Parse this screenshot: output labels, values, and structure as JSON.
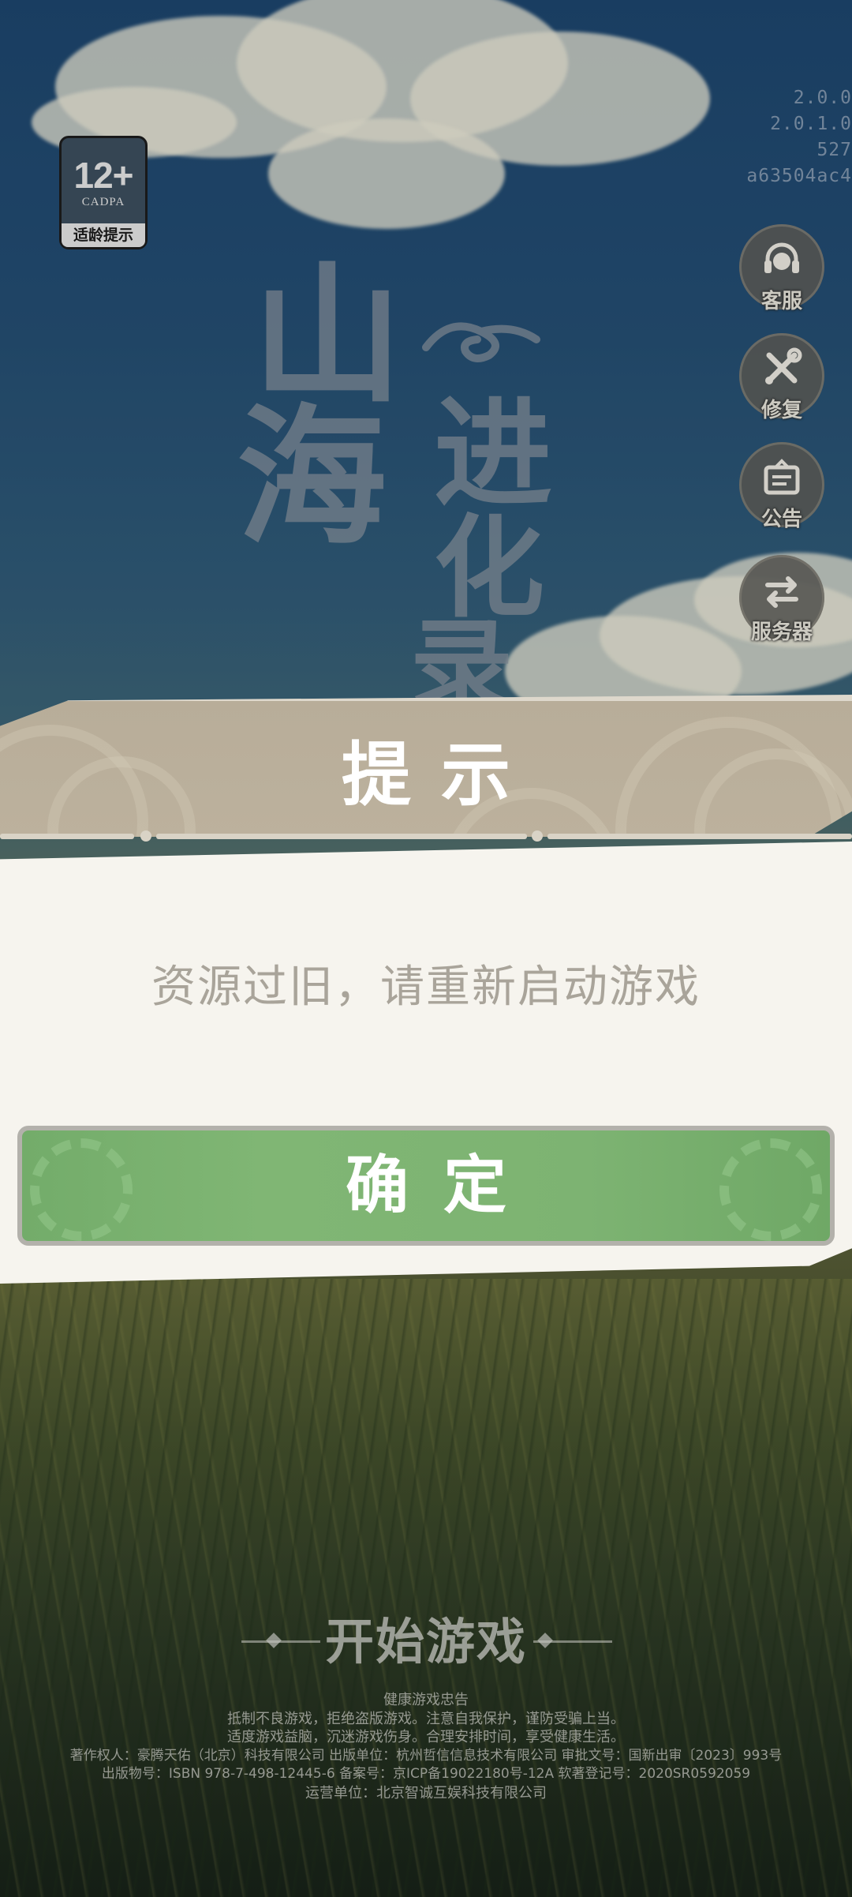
{
  "version": {
    "lines": [
      "2.0.0",
      "2.0.1.0",
      "527",
      "a63504ac4"
    ]
  },
  "age_rating": {
    "age": "12+",
    "org": "CADPA",
    "hint": "适龄提示"
  },
  "logo": {
    "chars": [
      "山",
      "海",
      "进",
      "化",
      "录"
    ]
  },
  "side_buttons": [
    {
      "label": "客服",
      "icon": "headset-icon"
    },
    {
      "label": "修复",
      "icon": "wrench-icon"
    },
    {
      "label": "公告",
      "icon": "notice-board-icon"
    },
    {
      "label": "服务器",
      "icon": "swap-arrows-icon"
    }
  ],
  "dialog": {
    "title": "提示",
    "message": "资源过旧，请重新启动游戏",
    "confirm_label": "确定"
  },
  "start_game": {
    "label": "开始游戏"
  },
  "footer": {
    "lines": [
      "健康游戏忠告",
      "抵制不良游戏，拒绝盗版游戏。注意自我保护，谨防受骗上当。",
      "适度游戏益脑，沉迷游戏伤身。合理安排时间，享受健康生活。",
      "著作权人：豪腾天佑（北京）科技有限公司  出版单位：杭州哲信信息技术有限公司  审批文号：国新出审〔2023〕993号",
      "出版物号：ISBN 978-7-498-12445-6  备案号：京ICP备19022180号-12A  软著登记号：2020SR0592059",
      "运营单位：北京智诚互娱科技有限公司"
    ]
  },
  "colors": {
    "sky": "#1d466f",
    "dialog_header": "#b8ad99",
    "dialog_body": "#f6f4ee",
    "confirm_green": "#7db372",
    "message_text": "#a9a49a"
  }
}
